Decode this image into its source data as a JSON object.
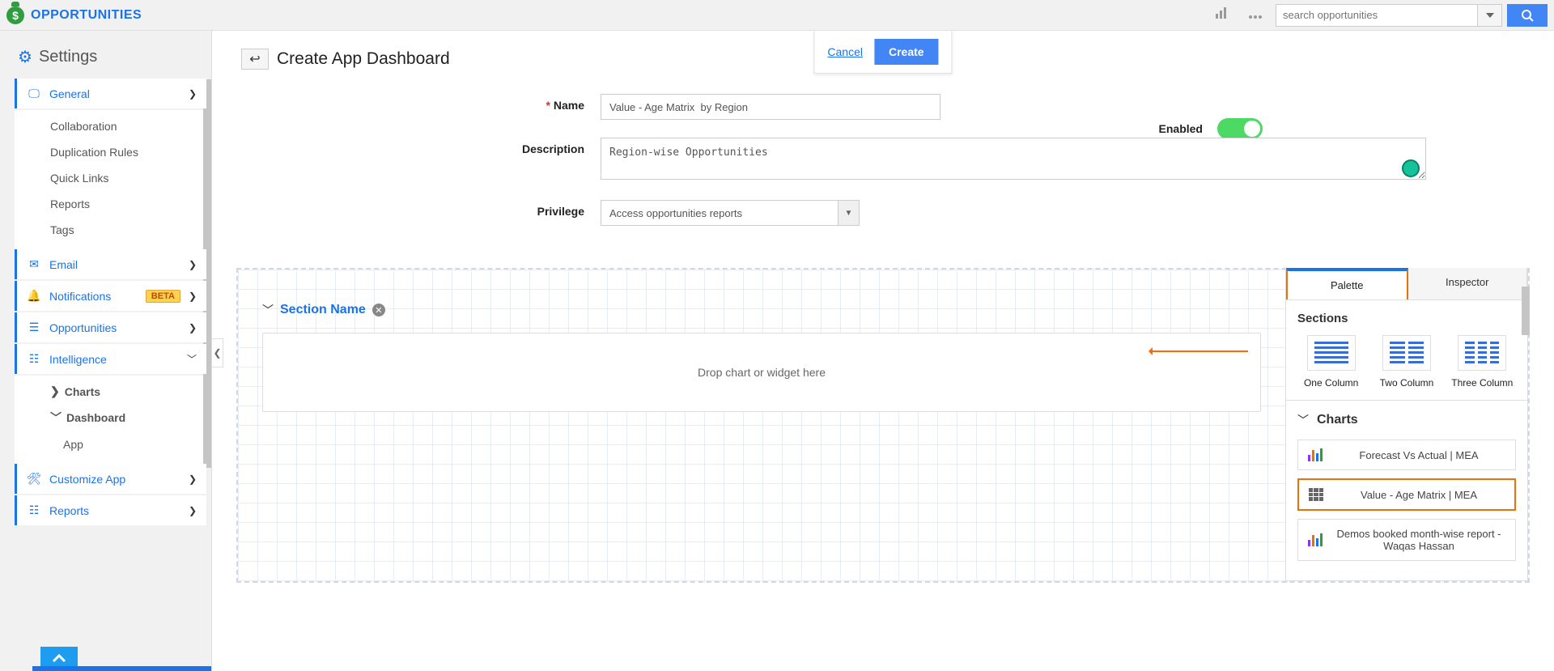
{
  "header": {
    "app_title": "OPPORTUNITIES",
    "search_placeholder": "search opportunities"
  },
  "sidebar": {
    "settings_title": "Settings",
    "items": {
      "general": "General",
      "general_subs": [
        "Collaboration",
        "Duplication Rules",
        "Quick Links",
        "Reports",
        "Tags"
      ],
      "email": "Email",
      "notifications": "Notifications",
      "notifications_badge": "BETA",
      "opportunities": "Opportunities",
      "intelligence": "Intelligence",
      "intelligence_subs": {
        "charts": "Charts",
        "dashboard": "Dashboard",
        "app": "App"
      },
      "customize": "Customize App",
      "reports": "Reports"
    }
  },
  "main": {
    "page_title": "Create App Dashboard",
    "cancel": "Cancel",
    "create": "Create",
    "form": {
      "name_label": "Name",
      "name_value": "Value - Age Matrix  by Region",
      "desc_label": "Description",
      "desc_value": "Region-wise Opportunities",
      "priv_label": "Privilege",
      "priv_value": "Access opportunities reports",
      "enabled_label": "Enabled"
    },
    "section": {
      "title": "Section Name",
      "drop_text": "Drop chart or widget here"
    }
  },
  "palette": {
    "tab_palette": "Palette",
    "tab_inspector": "Inspector",
    "sections_title": "Sections",
    "layouts": [
      "One Column",
      "Two Column",
      "Three Column"
    ],
    "charts_title": "Charts",
    "chart_items": [
      "Forecast Vs Actual | MEA",
      "Value - Age Matrix | MEA",
      "Demos booked month-wise report - Waqas Hassan"
    ]
  }
}
